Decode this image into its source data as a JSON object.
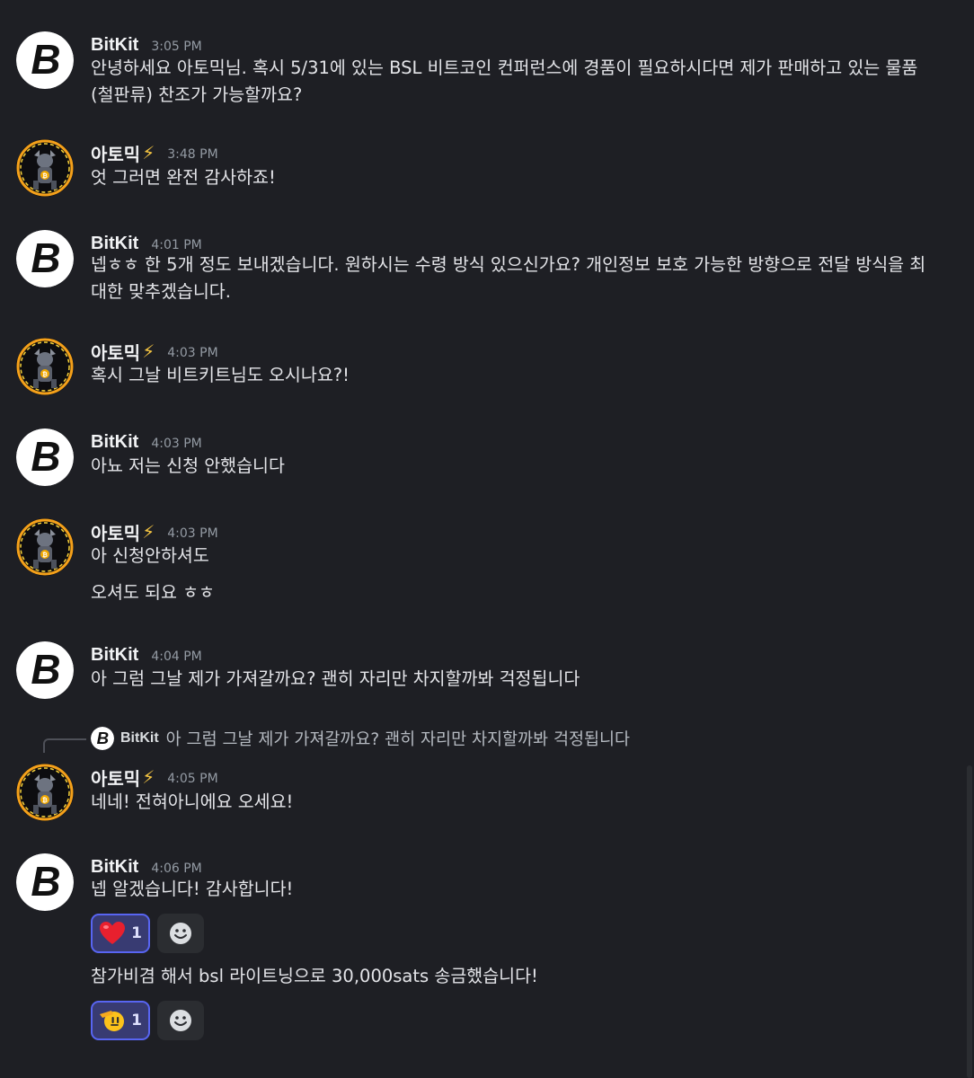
{
  "authors": {
    "bitkit": {
      "name": "BitKit",
      "avatar_icon": "bitkit-b-logo-icon"
    },
    "atomic": {
      "name": "아토믹",
      "badge": "⚡",
      "avatar_icon": "viking-bitcoin-avatar-icon"
    }
  },
  "messages": [
    {
      "author": "BitKit",
      "time": "3:05 PM",
      "lines": [
        "안녕하세요 아토믹님. 혹시 5/31에 있는 BSL 비트코인 컨퍼런스에 경품이 필요하시다면 제가 판매하고 있는 물품",
        "(철판류) 찬조가 가능할까요?"
      ]
    },
    {
      "author": "아토믹",
      "badge": "⚡",
      "time": "3:48 PM",
      "lines": [
        "엇 그러면 완전 감사하죠!"
      ]
    },
    {
      "author": "BitKit",
      "time": "4:01 PM",
      "lines": [
        "넵ㅎㅎ 한 5개 정도 보내겠습니다. 원하시는 수령 방식 있으신가요? 개인정보 보호 가능한 방향으로 전달 방식을 최",
        "대한 맞추겠습니다."
      ]
    },
    {
      "author": "아토믹",
      "badge": "⚡",
      "time": "4:03 PM",
      "lines": [
        "혹시 그날 비트키트님도 오시나요?!"
      ]
    },
    {
      "author": "BitKit",
      "time": "4:03 PM",
      "lines": [
        "아뇨 저는 신청 안했습니다"
      ]
    },
    {
      "author": "아토믹",
      "badge": "⚡",
      "time": "4:03 PM",
      "lines": [
        "아 신청안하셔도"
      ],
      "followup": "오셔도 되요 ㅎㅎ"
    },
    {
      "author": "BitKit",
      "time": "4:04 PM",
      "lines": [
        "아 그럼 그날 제가 가져갈까요? 괜히 자리만 차지할까봐 걱정됩니다"
      ]
    },
    {
      "author": "아토믹",
      "badge": "⚡",
      "time": "4:05 PM",
      "reply_to": {
        "author": "BitKit",
        "text": "아 그럼 그날 제가 가져갈까요? 괜히 자리만 차지할까봐 걱정됩니다"
      },
      "lines": [
        "네네! 전혀아니에요 오세요!"
      ]
    },
    {
      "author": "BitKit",
      "time": "4:06 PM",
      "lines": [
        "넵 알겠습니다! 감사합니다!"
      ],
      "reaction1": {
        "emoji_name": "red-heart",
        "count": "1"
      },
      "followup": "참가비겸 해서 bsl 라이트닝으로 30,000sats 송금했습니다!",
      "reaction2": {
        "emoji_name": "saluting-face",
        "count": "1"
      }
    }
  ],
  "colors": {
    "background": "#1e1f24",
    "reaction_bg": "#383b72",
    "reaction_border": "#5865f2",
    "timestamp": "#949ba4"
  }
}
